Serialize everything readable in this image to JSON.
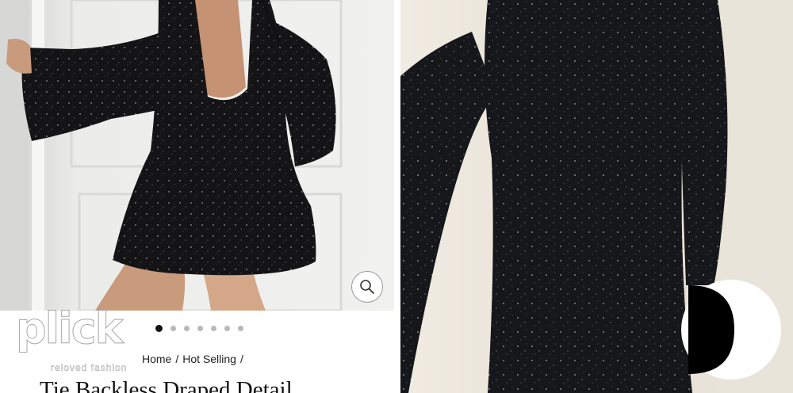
{
  "left_panel": {
    "carousel": {
      "total_slides": 7,
      "active_index": 0
    },
    "zoom": {
      "icon": "magnifier-icon"
    },
    "breadcrumb": {
      "items": [
        "Home",
        "Hot Selling"
      ],
      "separator": "/"
    },
    "product": {
      "title_partial": "Tie Backless Draped Detail"
    },
    "watermark": {
      "brand": "plick",
      "tagline": "reloved fashion"
    }
  },
  "right_panel": {
    "badge": {
      "icon": "half-circle-badge-icon"
    }
  },
  "colors": {
    "dress": "#141416",
    "sparkle": "#cfcfd6",
    "wall_left": "#e8e8e6",
    "wall_right": "#e9e4da",
    "dot_active": "#111111",
    "dot_inactive": "#b9b9b9"
  }
}
